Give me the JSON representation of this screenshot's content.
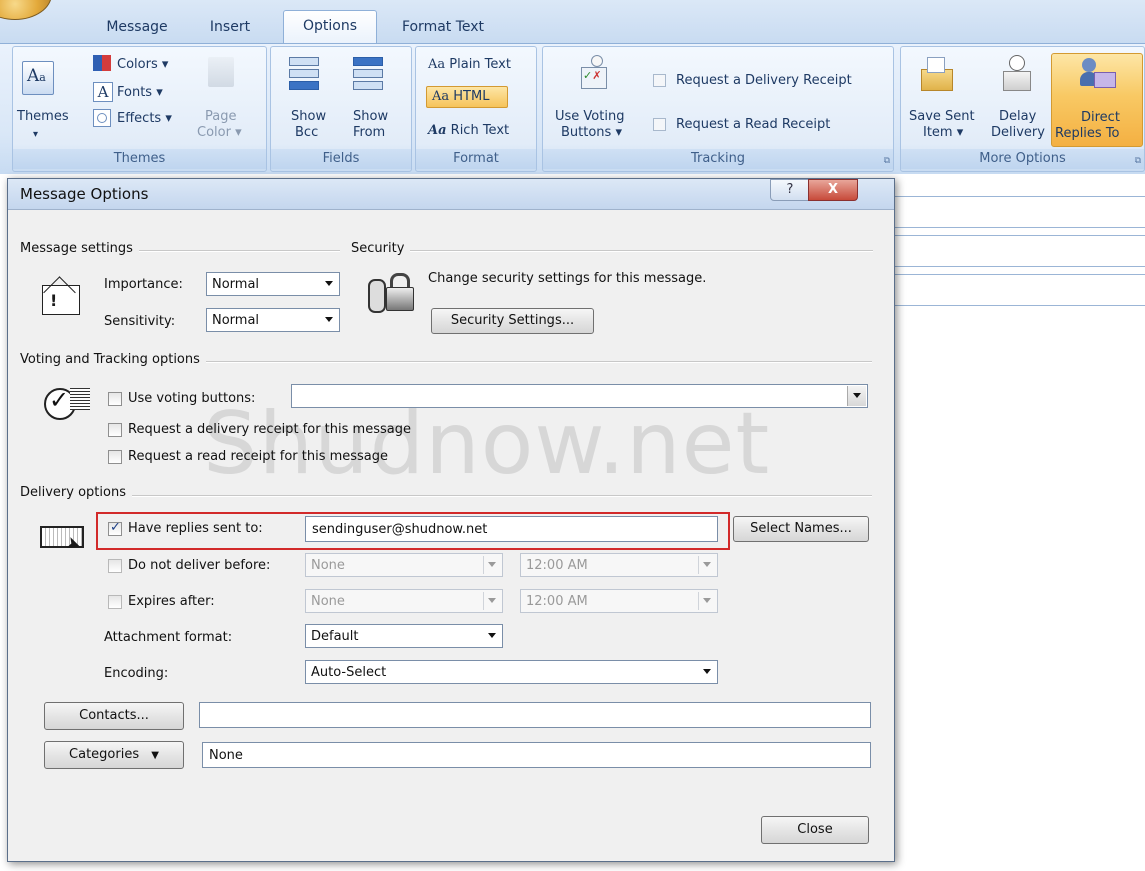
{
  "ribbon": {
    "tabs": [
      {
        "label": "Message",
        "active": false
      },
      {
        "label": "Insert",
        "active": false
      },
      {
        "label": "Options",
        "active": true
      },
      {
        "label": "Format Text",
        "active": false
      }
    ],
    "themes_group": {
      "label": "Themes",
      "themes_button": "Themes",
      "colors": "Colors ▾",
      "fonts": "Fonts ▾",
      "effects": "Effects ▾",
      "page_color_line1": "Page",
      "page_color_line2": "Color ▾"
    },
    "fields_group": {
      "label": "Fields",
      "show_bcc_line1": "Show",
      "show_bcc_line2": "Bcc",
      "show_from_line1": "Show",
      "show_from_line2": "From"
    },
    "format_group": {
      "label": "Format",
      "plain_text": "Plain Text",
      "html": "HTML",
      "rich_text": "Rich Text"
    },
    "tracking_group": {
      "label": "Tracking",
      "voting_line1": "Use Voting",
      "voting_line2": "Buttons ▾",
      "delivery_receipt": "Request a Delivery Receipt",
      "read_receipt": "Request a Read Receipt"
    },
    "more_options_group": {
      "label": "More Options",
      "save_sent_line1": "Save Sent",
      "save_sent_line2": "Item ▾",
      "delay_line1": "Delay",
      "delay_line2": "Delivery",
      "direct_line1": "Direct",
      "direct_line2": "Replies To"
    }
  },
  "dialog": {
    "title": "Message Options",
    "help_glyph": "?",
    "close_glyph": "X",
    "watermark": "Shudnow.net",
    "message_settings": {
      "heading": "Message settings",
      "importance_label": "Importance:",
      "importance_value": "Normal",
      "sensitivity_label": "Sensitivity:",
      "sensitivity_value": "Normal"
    },
    "security": {
      "heading": "Security",
      "description": "Change security settings for this message.",
      "button": "Security Settings..."
    },
    "voting_tracking": {
      "heading": "Voting and Tracking options",
      "use_voting_label": "Use voting buttons:",
      "use_voting_value": "",
      "delivery_receipt_label": "Request a delivery receipt for this message",
      "read_receipt_label": "Request a read receipt for this message"
    },
    "delivery": {
      "heading": "Delivery options",
      "replies_label": "Have replies sent to:",
      "replies_value": "sendinguser@shudnow.net",
      "select_names_button": "Select Names...",
      "not_before_label": "Do not deliver before:",
      "not_before_date": "None",
      "not_before_time": "12:00 AM",
      "expires_label": "Expires after:",
      "expires_date": "None",
      "expires_time": "12:00 AM",
      "attachment_label": "Attachment format:",
      "attachment_value": "Default",
      "encoding_label": "Encoding:",
      "encoding_value": "Auto-Select"
    },
    "contacts_button": "Contacts...",
    "contacts_value": "",
    "categories_button": "Categories",
    "categories_value": "None",
    "close_button": "Close"
  },
  "colors": {
    "highlight": "#d22a2a",
    "ribbon_bg": "#dbe8f7",
    "active_orange": "#f6c35a"
  }
}
